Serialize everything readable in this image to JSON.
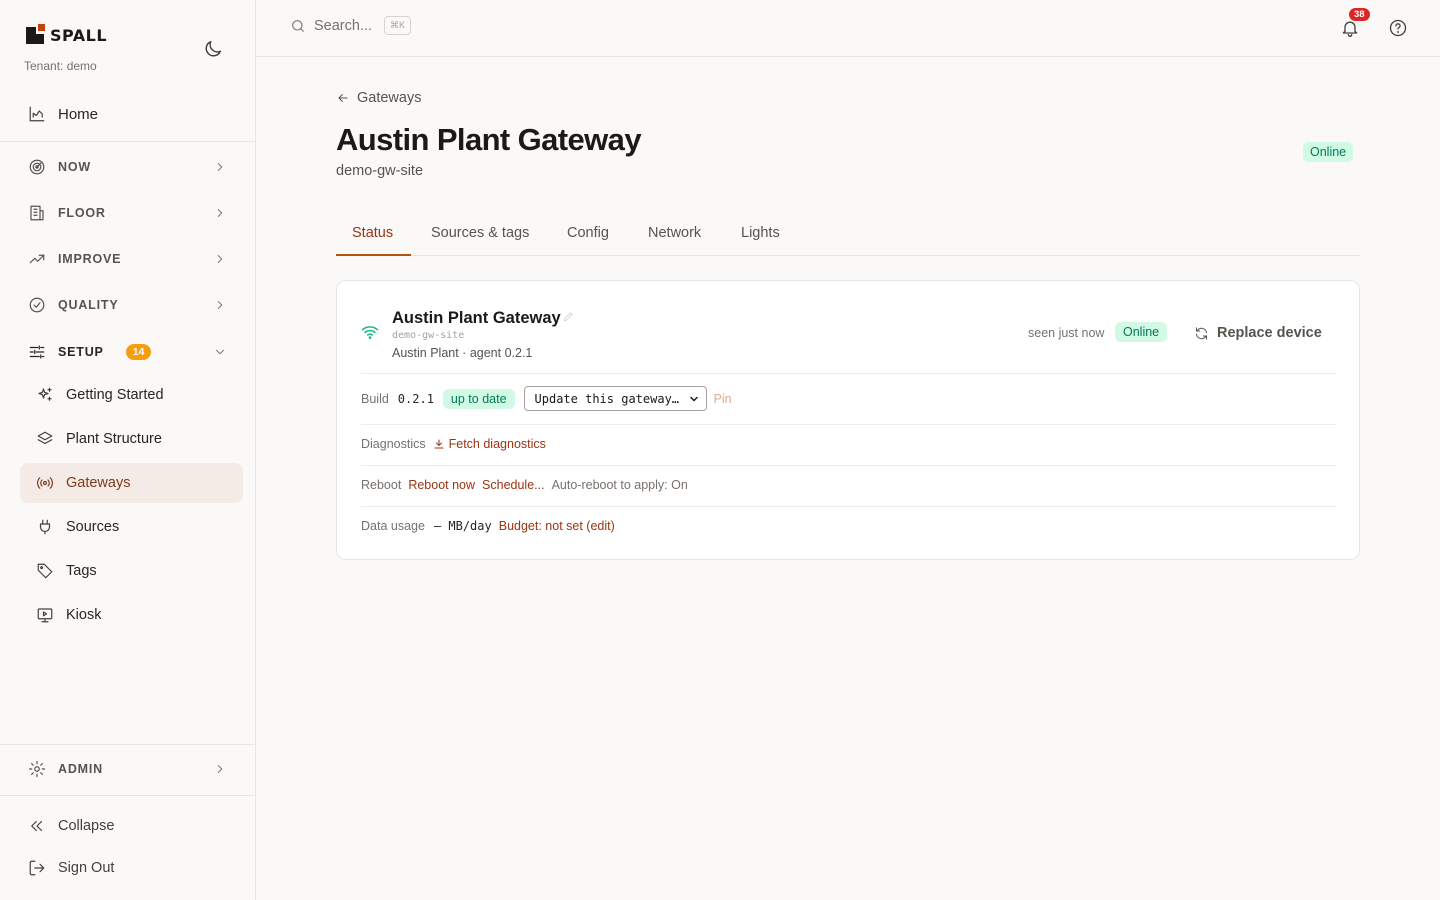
{
  "brand": {
    "name": "SPALL",
    "tenant": "Tenant: demo",
    "accent": "#c2410c"
  },
  "sidebar": {
    "home": "Home",
    "groups": {
      "now": "NOW",
      "floor": "FLOOR",
      "improve": "IMPROVE",
      "quality": "QUALITY",
      "setup": "SETUP",
      "setup_badge": "14",
      "admin": "ADMIN"
    },
    "setup_items": [
      "Getting Started",
      "Plant Structure",
      "Gateways",
      "Sources",
      "Tags",
      "Kiosk"
    ],
    "active_item": "Gateways",
    "collapse": "Collapse",
    "sign_out": "Sign Out"
  },
  "topbar": {
    "search_placeholder": "Search...",
    "search_shortcut": "⌘K",
    "notification_count": "38"
  },
  "page": {
    "breadcrumb": "Gateways",
    "title": "Austin Plant Gateway",
    "subtitle": "demo-gw-site",
    "status": "Online",
    "status_color": "#047857"
  },
  "tabs": [
    "Status",
    "Sources & tags",
    "Config",
    "Network",
    "Lights"
  ],
  "active_tab": "Status",
  "card": {
    "name": "Austin Plant Gateway",
    "id": "demo-gw-site",
    "meta": "Austin Plant · agent 0.2.1",
    "seen": "seen just now",
    "status": "Online",
    "replace_label": "Replace device",
    "build": {
      "label": "Build",
      "version": "0.2.1",
      "state": "up to date",
      "select_value": "Update this gateway…",
      "pin": "Pin"
    },
    "diagnostics": {
      "label": "Diagnostics",
      "action": "Fetch diagnostics"
    },
    "reboot": {
      "label": "Reboot",
      "now": "Reboot now",
      "schedule": "Schedule...",
      "auto": "Auto-reboot to apply: On"
    },
    "data_usage": {
      "label": "Data usage",
      "value": "— MB/day",
      "budget": "Budget: not set (edit)"
    }
  }
}
